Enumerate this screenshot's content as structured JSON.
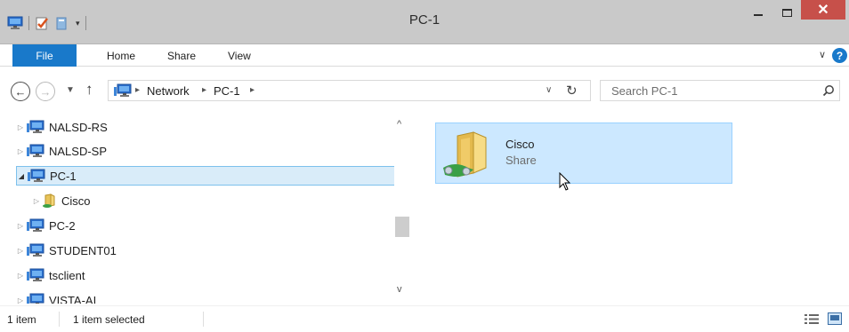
{
  "window": {
    "title": "PC-1",
    "close_glyph": "✕",
    "qat_dropdown_glyph": "▾"
  },
  "ribbon": {
    "tabs": [
      "File",
      "Home",
      "Share",
      "View"
    ],
    "collapse_glyph": "∨",
    "help_glyph": "?"
  },
  "navigation": {
    "back_glyph": "←",
    "forward_glyph": "→",
    "recent_glyph": "▼",
    "up_glyph": "↑",
    "address": {
      "segments": [
        "Network",
        "PC-1"
      ],
      "separator": "▸",
      "dropdown_glyph": "∨",
      "refresh_glyph": "↻"
    },
    "search_placeholder": "Search PC-1"
  },
  "tree": {
    "expand_glyph": "▷",
    "expanded_glyph": "◢",
    "items": [
      {
        "label": "NALSD-RS",
        "type": "computer"
      },
      {
        "label": "NALSD-SP",
        "type": "computer"
      },
      {
        "label": "PC-1",
        "type": "computer",
        "selected": true,
        "expanded": true
      },
      {
        "label": "Cisco",
        "type": "share"
      },
      {
        "label": "PC-2",
        "type": "computer"
      },
      {
        "label": "STUDENT01",
        "type": "computer"
      },
      {
        "label": "tsclient",
        "type": "computer"
      },
      {
        "label": "VISTA-AI",
        "type": "computer"
      }
    ],
    "scroll_up_glyph": "^",
    "scroll_down_glyph": "v"
  },
  "content": {
    "items": [
      {
        "name": "Cisco",
        "type": "Share",
        "selected": true
      }
    ]
  },
  "status": {
    "count": "1 item",
    "selected": "1 item selected"
  },
  "colors": {
    "accent": "#1979ca",
    "selection_bg": "#cce8ff",
    "selection_border": "#99d1ff",
    "close_button": "#c7504a",
    "titlebar": "#c9c9c9"
  }
}
